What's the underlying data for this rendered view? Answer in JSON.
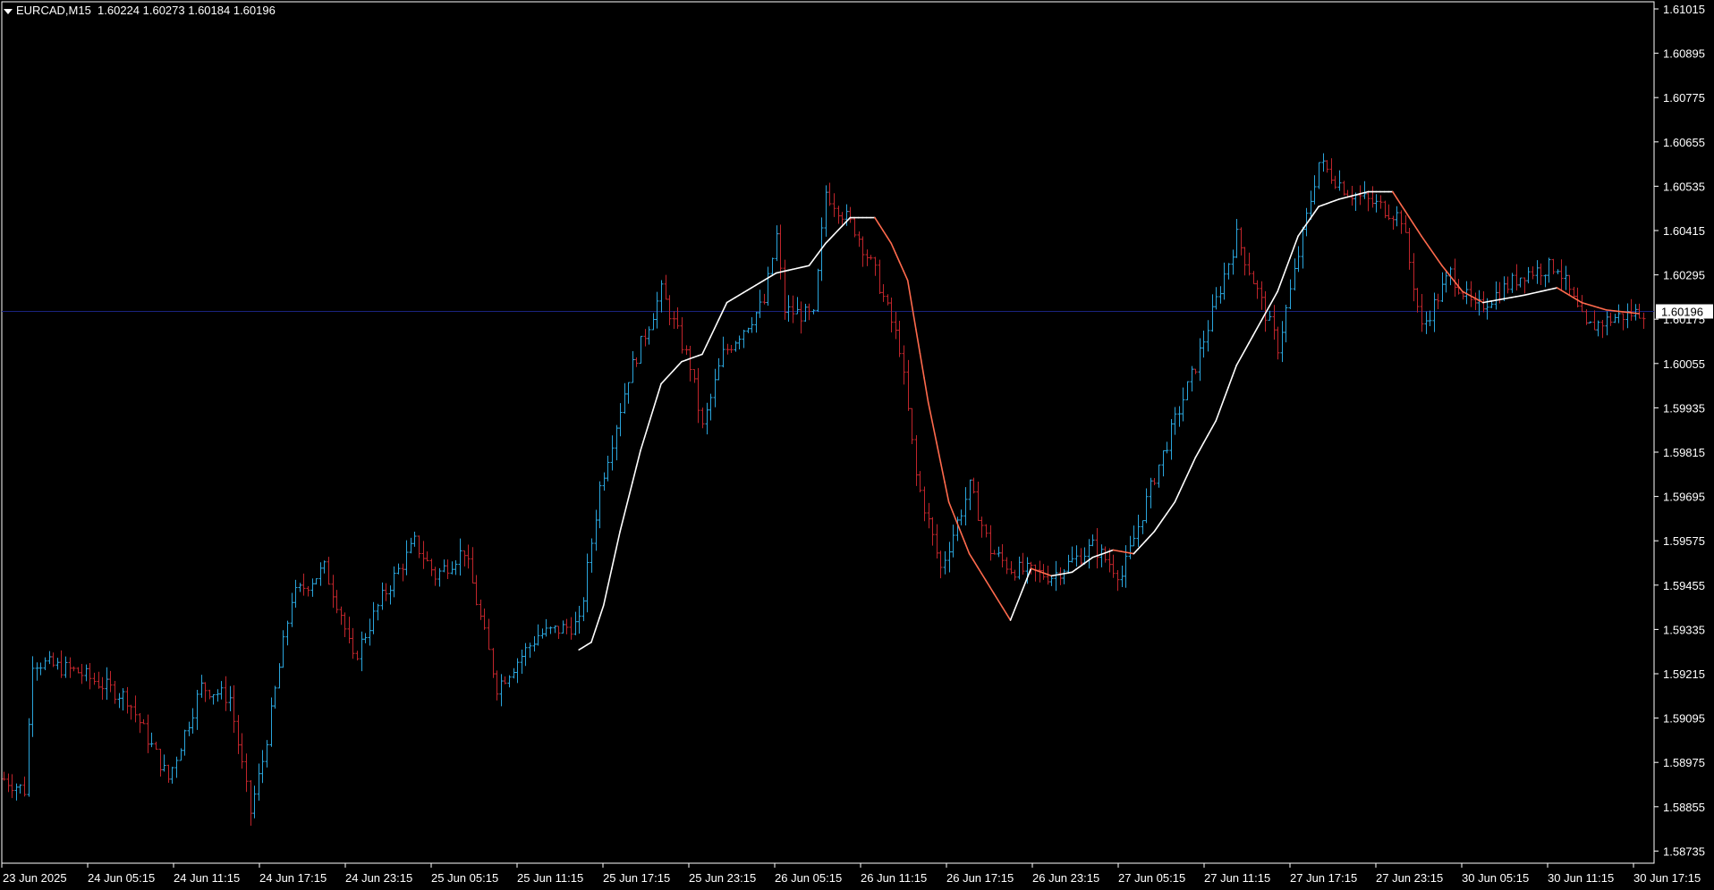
{
  "header": {
    "symbol": "EURCAD,M15",
    "ohlc": "1.60224 1.60273 1.60184 1.60196"
  },
  "colors": {
    "background": "#000000",
    "bull": "#2aa5dc",
    "bear": "#c0252b",
    "ma_up": "#ffffff",
    "ma_down": "#ff6a4d",
    "bid_line": "#1a237e",
    "axis": "#ffffff"
  },
  "chart_data": {
    "type": "candlestick-bars",
    "symbol": "EURCAD",
    "timeframe": "M15",
    "last_price": "1.60196",
    "y_ticks": [
      "1.61015",
      "1.60895",
      "1.60775",
      "1.60655",
      "1.60535",
      "1.60415",
      "1.60295",
      "1.60175",
      "1.60055",
      "1.59935",
      "1.59815",
      "1.59695",
      "1.59575",
      "1.59455",
      "1.59335",
      "1.59215",
      "1.59095",
      "1.58975",
      "1.58855",
      "1.58735"
    ],
    "ylim": [
      1.5871,
      1.6104
    ],
    "x_ticks": [
      "23 Jun 2025",
      "24 Jun 05:15",
      "24 Jun 11:15",
      "24 Jun 17:15",
      "24 Jun 23:15",
      "25 Jun 05:15",
      "25 Jun 11:15",
      "25 Jun 17:15",
      "25 Jun 23:15",
      "26 Jun 05:15",
      "26 Jun 11:15",
      "26 Jun 17:15",
      "26 Jun 23:15",
      "27 Jun 05:15",
      "27 Jun 11:15",
      "27 Jun 17:15",
      "27 Jun 23:15",
      "30 Jun 05:15",
      "30 Jun 11:15",
      "30 Jun 17:15"
    ],
    "bar_count": 400,
    "price_path": [
      [
        0,
        1.5893
      ],
      [
        5,
        1.589
      ],
      [
        7,
        1.5925
      ],
      [
        18,
        1.5922
      ],
      [
        30,
        1.5915
      ],
      [
        40,
        1.5893
      ],
      [
        48,
        1.5918
      ],
      [
        55,
        1.5915
      ],
      [
        60,
        1.5884
      ],
      [
        63,
        1.5898
      ],
      [
        70,
        1.5942
      ],
      [
        78,
        1.595
      ],
      [
        82,
        1.5938
      ],
      [
        85,
        1.5925
      ],
      [
        92,
        1.5942
      ],
      [
        100,
        1.5957
      ],
      [
        105,
        1.5948
      ],
      [
        112,
        1.5955
      ],
      [
        120,
        1.5918
      ],
      [
        130,
        1.5932
      ],
      [
        140,
        1.5935
      ],
      [
        145,
        1.5972
      ],
      [
        152,
        1.6002
      ],
      [
        160,
        1.6025
      ],
      [
        167,
        1.6005
      ],
      [
        170,
        1.5988
      ],
      [
        175,
        1.6008
      ],
      [
        185,
        1.6022
      ],
      [
        188,
        1.604
      ],
      [
        190,
        1.602
      ],
      [
        197,
        1.6018
      ],
      [
        200,
        1.6052
      ],
      [
        207,
        1.6042
      ],
      [
        212,
        1.603
      ],
      [
        218,
        1.601
      ],
      [
        222,
        1.5975
      ],
      [
        228,
        1.595
      ],
      [
        235,
        1.5972
      ],
      [
        240,
        1.5955
      ],
      [
        245,
        1.595
      ],
      [
        255,
        1.5948
      ],
      [
        265,
        1.5956
      ],
      [
        272,
        1.5948
      ],
      [
        280,
        1.5975
      ],
      [
        290,
        1.6005
      ],
      [
        300,
        1.604
      ],
      [
        310,
        1.601
      ],
      [
        320,
        1.606
      ],
      [
        327,
        1.6052
      ],
      [
        335,
        1.6048
      ],
      [
        340,
        1.6045
      ],
      [
        345,
        1.6015
      ],
      [
        352,
        1.603
      ],
      [
        358,
        1.602
      ],
      [
        370,
        1.603
      ],
      [
        378,
        1.6032
      ],
      [
        385,
        1.6015
      ],
      [
        392,
        1.6018
      ],
      [
        400,
        1.602
      ]
    ],
    "ma_path": [
      [
        140,
        1.5928
      ],
      [
        143,
        1.593
      ],
      [
        146,
        1.594
      ],
      [
        150,
        1.596
      ],
      [
        155,
        1.5982
      ],
      [
        160,
        1.6
      ],
      [
        165,
        1.6006
      ],
      [
        170,
        1.6008
      ],
      [
        176,
        1.6022
      ],
      [
        182,
        1.6026
      ],
      [
        188,
        1.603
      ],
      [
        192,
        1.6031
      ],
      [
        196,
        1.6032
      ],
      [
        200,
        1.6038
      ],
      [
        206,
        1.6045
      ],
      [
        212,
        1.6045
      ],
      [
        216,
        1.6038
      ],
      [
        220,
        1.6028
      ],
      [
        225,
        1.5995
      ],
      [
        230,
        1.5968
      ],
      [
        235,
        1.5954
      ],
      [
        240,
        1.5945
      ],
      [
        245,
        1.5936
      ],
      [
        250,
        1.595
      ],
      [
        255,
        1.5948
      ],
      [
        260,
        1.5949
      ],
      [
        265,
        1.5953
      ],
      [
        270,
        1.5955
      ],
      [
        275,
        1.5954
      ],
      [
        280,
        1.596
      ],
      [
        285,
        1.5968
      ],
      [
        290,
        1.598
      ],
      [
        295,
        1.599
      ],
      [
        300,
        1.6005
      ],
      [
        305,
        1.6015
      ],
      [
        310,
        1.6025
      ],
      [
        315,
        1.604
      ],
      [
        320,
        1.6048
      ],
      [
        325,
        1.605
      ],
      [
        332,
        1.6052
      ],
      [
        338,
        1.6052
      ],
      [
        345,
        1.604
      ],
      [
        350,
        1.6032
      ],
      [
        355,
        1.6025
      ],
      [
        360,
        1.6022
      ],
      [
        370,
        1.6024
      ],
      [
        378,
        1.6026
      ],
      [
        384,
        1.6022
      ],
      [
        390,
        1.602
      ],
      [
        398,
        1.6019
      ]
    ]
  }
}
